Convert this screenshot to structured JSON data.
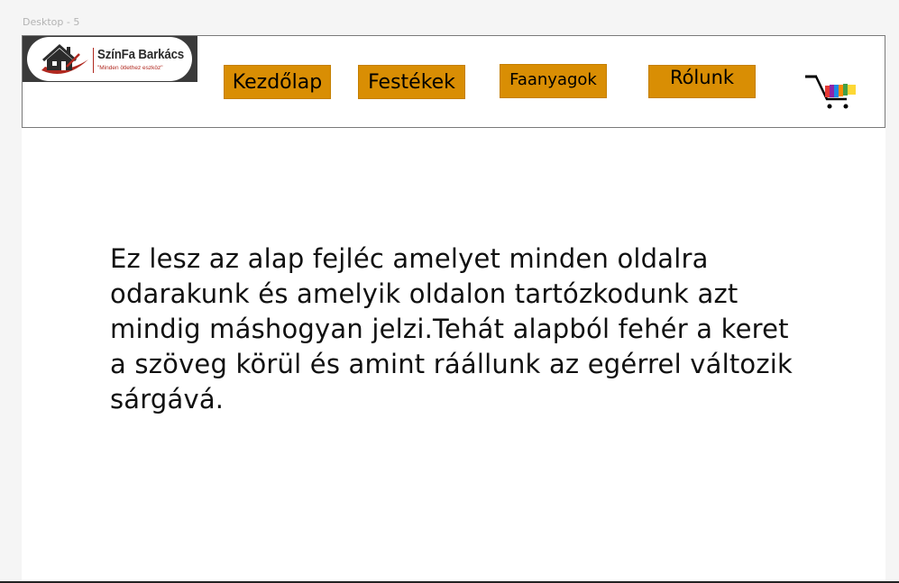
{
  "canvas": {
    "frame_label": "Desktop - 5"
  },
  "header": {
    "logo": {
      "title": "SzínFa Barkács",
      "tagline": "\"Minden ötlethez eszköz\"",
      "brand_red": "#b0281f"
    },
    "nav": {
      "home_label": "Kezdőlap",
      "paints_label": "Festékek",
      "woods_label": "Faanyagok",
      "about_label": "Rólunk"
    },
    "cart_icon": "shopping-cart-icon",
    "accent_color": "#d98e04"
  },
  "main": {
    "description": "Ez lesz az alap fejléc amelyet minden oldalra odarakunk és amelyik oldalon tartózkodunk azt mindig máshogyan jelzi.Tehát alapból fehér a keret a szöveg körül és amint ráállunk az egérrel változik sárgává."
  }
}
